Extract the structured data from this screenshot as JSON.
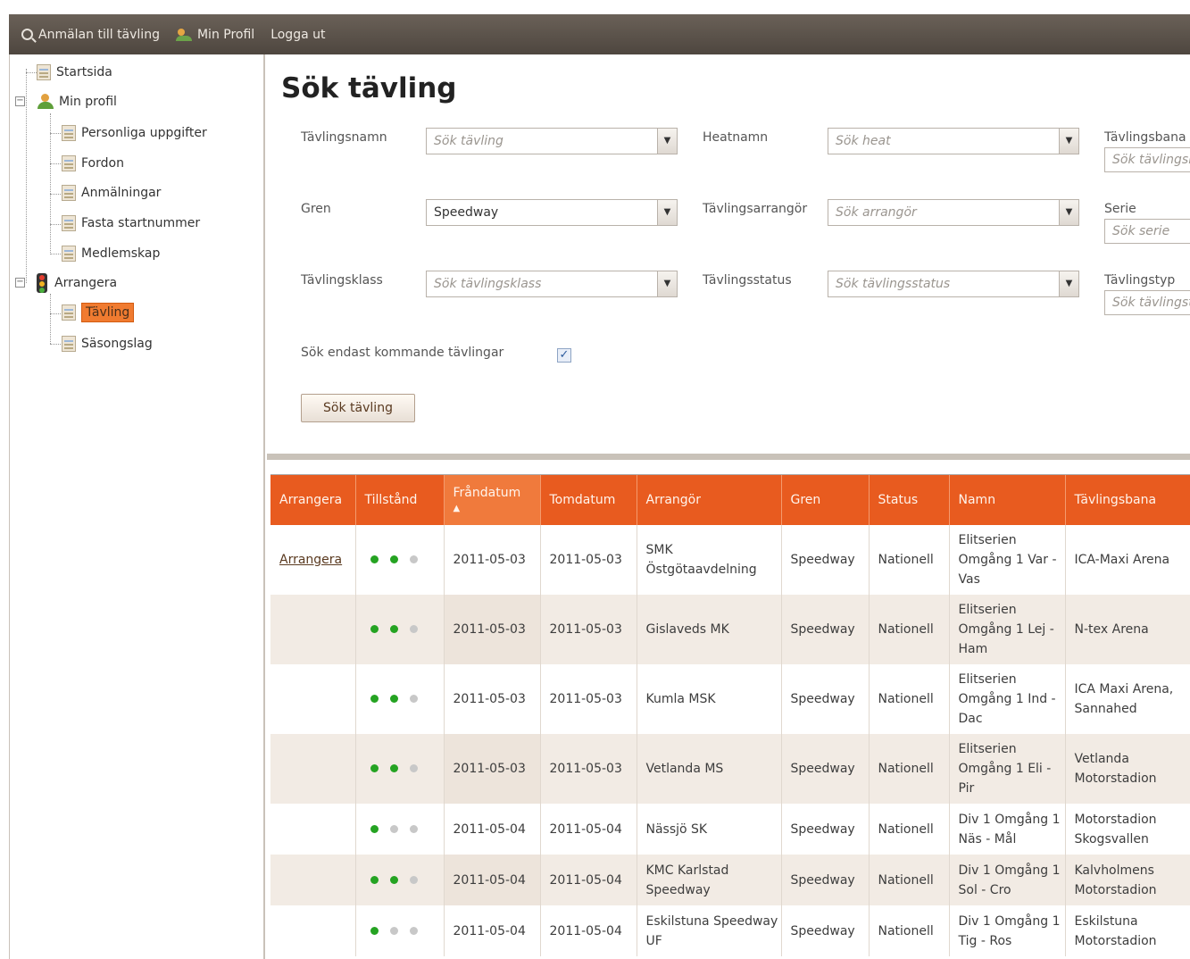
{
  "menu": {
    "items": [
      {
        "label": "Anmälan till tävling",
        "icon": "search-icon"
      },
      {
        "label": "Min Profil",
        "icon": "users-icon"
      },
      {
        "label": "Logga ut",
        "icon": ""
      }
    ]
  },
  "tree": {
    "startsida": "Startsida",
    "min_profil": "Min profil",
    "personliga": "Personliga uppgifter",
    "fordon": "Fordon",
    "anmalningar": "Anmälningar",
    "fasta": "Fasta startnummer",
    "medlemskap": "Medlemskap",
    "arrangera": "Arrangera",
    "tavling": "Tävling",
    "sasongslag": "Säsongslag",
    "expand_minus": "−"
  },
  "search": {
    "title": "Sök tävling",
    "tavlingsnamn_label": "Tävlingsnamn",
    "tavlingsnamn_placeholder": "Sök tävling",
    "heatnamn_label": "Heatnamn",
    "heatnamn_placeholder": "Sök heat",
    "tavlingsbana_label": "Tävlingsbana",
    "tavlingsbana_placeholder": "Sök tävlingsbana",
    "gren_label": "Gren",
    "gren_value": "Speedway",
    "arrangor_label": "Tävlingsarrangör",
    "arrangor_placeholder": "Sök arrangör",
    "serie_label": "Serie",
    "serie_placeholder": "Sök serie",
    "klass_label": "Tävlingsklass",
    "klass_placeholder": "Sök tävlingsklass",
    "status_label": "Tävlingsstatus",
    "status_placeholder": "Sök tävlingsstatus",
    "typ_label": "Tävlingstyp",
    "typ_placeholder": "Sök tävlingstyp",
    "kommande_label": "Sök endast kommande tävlingar",
    "kommande_checked": true,
    "check_mark": "✓",
    "dropdown_arrow": "▼",
    "button_label": "Sök tävling"
  },
  "grid": {
    "sort_indicator": "▲",
    "columns": [
      "Arrangera",
      "Tillstånd",
      "Fråndatum",
      "Tomdatum",
      "Arrangör",
      "Gren",
      "Status",
      "Namn",
      "Tävlingsbana"
    ],
    "rows": [
      {
        "arrangera": "Arrangera",
        "state": [
          1,
          1,
          0
        ],
        "from": "2011-05-03",
        "tom": "2011-05-03",
        "arrangor": "SMK Östgötaavdelning",
        "gren": "Speedway",
        "status": "Nationell",
        "namn": "Elitserien Omgång 1 Var - Vas",
        "bana": "ICA-Maxi Arena"
      },
      {
        "arrangera": "",
        "state": [
          1,
          1,
          0
        ],
        "from": "2011-05-03",
        "tom": "2011-05-03",
        "arrangor": "Gislaveds MK",
        "gren": "Speedway",
        "status": "Nationell",
        "namn": "Elitserien Omgång 1 Lej - Ham",
        "bana": "N-tex Arena"
      },
      {
        "arrangera": "",
        "state": [
          1,
          1,
          0
        ],
        "from": "2011-05-03",
        "tom": "2011-05-03",
        "arrangor": "Kumla MSK",
        "gren": "Speedway",
        "status": "Nationell",
        "namn": "Elitserien Omgång 1 Ind - Dac",
        "bana": "ICA Maxi Arena, Sannahed"
      },
      {
        "arrangera": "",
        "state": [
          1,
          1,
          0
        ],
        "from": "2011-05-03",
        "tom": "2011-05-03",
        "arrangor": "Vetlanda MS",
        "gren": "Speedway",
        "status": "Nationell",
        "namn": "Elitserien Omgång 1 Eli - Pir",
        "bana": "Vetlanda Motorstadion"
      },
      {
        "arrangera": "",
        "state": [
          1,
          0,
          0
        ],
        "from": "2011-05-04",
        "tom": "2011-05-04",
        "arrangor": "Nässjö SK",
        "gren": "Speedway",
        "status": "Nationell",
        "namn": "Div 1 Omgång 1 Näs - Mål",
        "bana": "Motorstadion Skogsvallen"
      },
      {
        "arrangera": "",
        "state": [
          1,
          1,
          0
        ],
        "from": "2011-05-04",
        "tom": "2011-05-04",
        "arrangor": "KMC Karlstad Speedway",
        "gren": "Speedway",
        "status": "Nationell",
        "namn": "Div 1 Omgång 1 Sol - Cro",
        "bana": "Kalvholmens Motorstadion"
      },
      {
        "arrangera": "",
        "state": [
          1,
          0,
          0
        ],
        "from": "2011-05-04",
        "tom": "2011-05-04",
        "arrangor": "Eskilstuna Speedway UF",
        "gren": "Speedway",
        "status": "Nationell",
        "namn": "Div 1 Omgång 1 Tig - Ros",
        "bana": "Eskilstuna Motorstadion"
      }
    ]
  },
  "colors": {
    "accent": "#e85b1f",
    "selected": "#f07b30",
    "status_on": "#25a322",
    "status_off": "#c8c8c8"
  }
}
